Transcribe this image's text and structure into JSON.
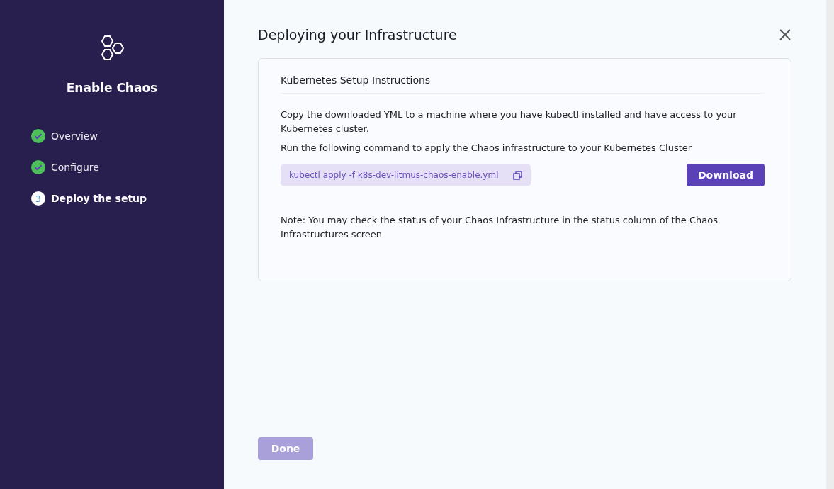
{
  "sidebar": {
    "title": "Enable Chaos",
    "steps": [
      {
        "label": "Overview",
        "completed": true,
        "selected": false
      },
      {
        "label": "Configure",
        "completed": true,
        "selected": false
      },
      {
        "label": "Deploy the setup",
        "number": "3",
        "completed": false,
        "selected": true
      }
    ]
  },
  "dialog": {
    "title": "Deploying your Infrastructure",
    "card": {
      "heading": "Kubernetes Setup Instructions",
      "paragraphs": [
        "Copy the downloaded YML to a machine where you have kubectl installed and have access to your Kubernetes cluster.",
        "Run the following command to apply the Chaos infrastructure to your Kubernetes Cluster"
      ],
      "command": "kubectl apply -f k8s-dev-litmus-chaos-enable.yml",
      "download_button": "Download",
      "note": "Note: You may check the status of your Chaos Infrastructure in the status column of the Chaos Infrastructures screen"
    },
    "done_button": {
      "label": "Done",
      "disabled": true
    }
  }
}
